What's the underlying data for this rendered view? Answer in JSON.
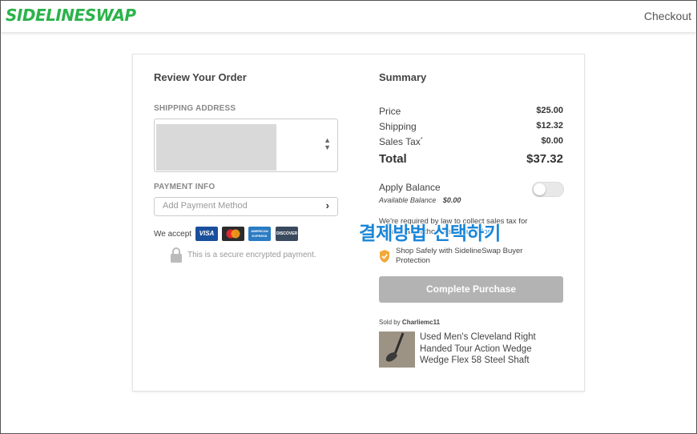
{
  "header": {
    "logo_text": "SIDELINESWAP",
    "checkout_link": "Checkout",
    "brand_color": "#2bb34b"
  },
  "left": {
    "title": "Review Your Order",
    "shipping_label": "SHIPPING ADDRESS",
    "payment_label": "PAYMENT INFO",
    "payment_placeholder": "Add Payment Method",
    "we_accept": "We accept",
    "cards": [
      {
        "name": "VISA",
        "color": "#1a4f9c"
      },
      {
        "name": "mastercard",
        "color": "#2b2b2b"
      },
      {
        "name": "AMERICAN EXPRESS",
        "color": "#2a7bc4"
      },
      {
        "name": "DISCOVER",
        "color": "#3a4a5e"
      }
    ],
    "secure_text": "This is a secure encrypted payment."
  },
  "overlay_text": "결제방법 선택하기",
  "summary": {
    "title": "Summary",
    "price_label": "Price",
    "price_value": "$25.00",
    "shipping_label": "Shipping",
    "shipping_value": "$12.32",
    "tax_label": "Sales Tax",
    "tax_mark": "*",
    "tax_value": "$0.00",
    "total_label": "Total",
    "total_value": "$37.32",
    "balance_label": "Apply Balance",
    "available_label": "Available Balance",
    "available_value": "$0.00",
    "tax_note": "We're required by law to collect sales tax for certain tax authorities.",
    "learn_more": "Learn More",
    "protection_text": "Shop Safely with SidelineSwap Buyer Protection",
    "complete_button": "Complete Purchase",
    "sold_by_prefix": "Sold by",
    "seller": "Charliemc11",
    "product_title": "Used Men's Cleveland Right Handed Tour Action Wedge Wedge Flex 58 Steel Shaft"
  }
}
